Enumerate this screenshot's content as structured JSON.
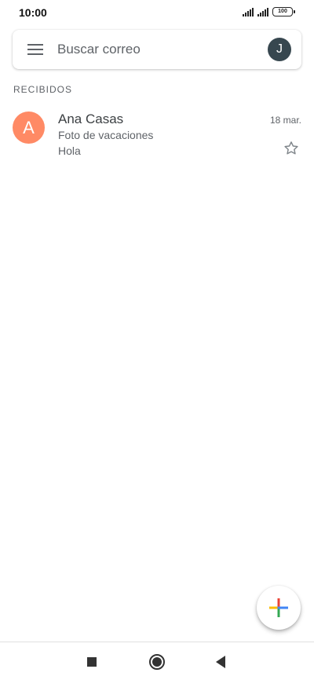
{
  "status_bar": {
    "time": "10:00",
    "battery": "100",
    "icons": [
      "signal-icon",
      "signal-icon",
      "battery-icon"
    ]
  },
  "search": {
    "placeholder": "Buscar correo",
    "menu_icon": "menu-icon",
    "account_initial": "J"
  },
  "section": {
    "label": "RECIBIDOS"
  },
  "emails": [
    {
      "avatar_initial": "A",
      "sender": "Ana Casas",
      "date": "18 mar.",
      "subject": "Foto de vacaciones",
      "snippet": "Hola",
      "starred": false
    }
  ],
  "fab": {
    "icon": "compose-plus-icon"
  },
  "nav": {
    "icons": [
      "recents-icon",
      "home-icon",
      "back-icon"
    ]
  },
  "colors": {
    "sender_avatar": "#ff8a65",
    "account_avatar": "#37474f",
    "google_blue": "#4285f4",
    "google_red": "#ea4335",
    "google_yellow": "#fbbc04",
    "google_green": "#34a853"
  }
}
